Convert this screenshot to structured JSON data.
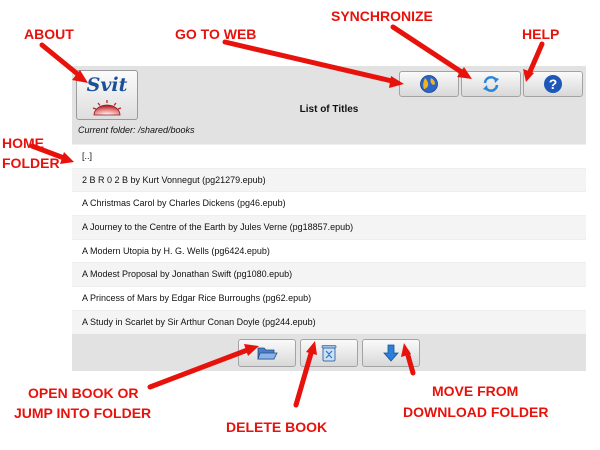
{
  "app": {
    "logo_text": "Svit",
    "title": "List of Titles",
    "current_folder": "Current folder: /shared/books"
  },
  "list": {
    "items": [
      "[..]",
      "2 B R 0 2 B by Kurt Vonnegut (pg21279.epub)",
      "A Christmas Carol by Charles Dickens (pg46.epub)",
      "A Journey to the Centre of the Earth by Jules Verne (pg18857.epub)",
      "A Modern Utopia by H. G. Wells (pg6424.epub)",
      "A Modest Proposal by Jonathan Swift (pg1080.epub)",
      "A Princess of Mars by Edgar Rice Burroughs (pg62.epub)",
      "A Study in Scarlet by Sir Arthur Conan Doyle (pg244.epub)"
    ]
  },
  "annotations": {
    "about": "ABOUT",
    "go_to_web": "GO TO WEB",
    "synchronize": "SYNCHRONIZE",
    "help": "HELP",
    "home_folder_1": "HOME",
    "home_folder_2": "FOLDER",
    "open_book_1": "OPEN BOOK OR",
    "open_book_2": "JUMP INTO FOLDER",
    "delete_book": "DELETE BOOK",
    "move_download_1": "MOVE FROM",
    "move_download_2": "DOWNLOAD FOLDER"
  },
  "colors": {
    "annotation": "#e8120c",
    "toolbar": "#e2e2e2",
    "accent_blue": "#1d6fd1"
  },
  "icons": {
    "web": "globe-icon",
    "sync": "sync-icon",
    "help": "help-icon",
    "open": "folder-open-icon",
    "delete": "trash-icon",
    "move": "arrow-down-icon"
  }
}
